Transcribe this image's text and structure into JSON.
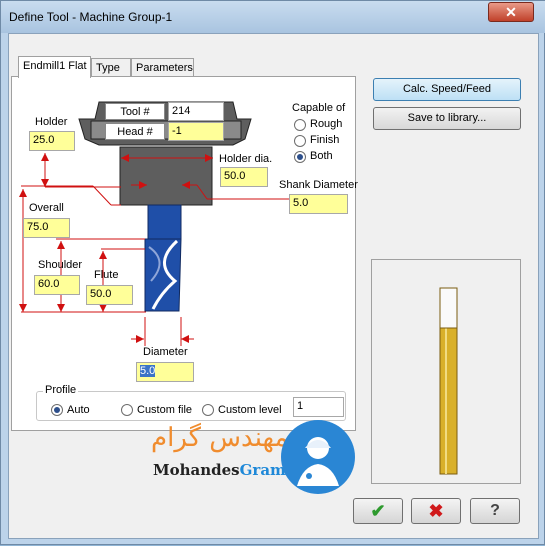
{
  "window": {
    "title": "Define Tool - Machine Group-1",
    "close_glyph": "✕"
  },
  "tabs": [
    {
      "label": "Endmill1 Flat"
    },
    {
      "label": "Type"
    },
    {
      "label": "Parameters"
    }
  ],
  "tool": {
    "tool_no_label": "Tool #",
    "tool_no_value": "214",
    "head_no_label": "Head #",
    "head_no_value": "-1",
    "holder_label": "Holder",
    "holder_value": "25.0",
    "holder_dia_label": "Holder dia.",
    "holder_dia_value": "50.0",
    "shank_diameter_label": "Shank Diameter",
    "shank_diameter_value": "5.0",
    "overall_label": "Overall",
    "overall_value": "75.0",
    "shoulder_label": "Shoulder",
    "shoulder_value": "60.0",
    "flute_label": "Flute",
    "flute_value": "50.0",
    "diameter_label": "Diameter",
    "diameter_value": "5.0"
  },
  "capable": {
    "title": "Capable of",
    "options": [
      "Rough",
      "Finish",
      "Both"
    ],
    "selected": "Both"
  },
  "profile": {
    "title": "Profile",
    "options": [
      "Auto",
      "Custom file",
      "Custom level"
    ],
    "selected": "Auto",
    "level_value": "1"
  },
  "buttons": {
    "calc": "Calc. Speed/Feed",
    "save_library": "Save to library..."
  },
  "footer": {
    "ok_glyph": "✔",
    "cancel_glyph": "✖",
    "help_glyph": "?"
  },
  "watermark": {
    "persian": "مهندس گرام",
    "latin_a": "Mohandes",
    "latin_b": "Gram"
  },
  "colors": {
    "field_yellow": "#ffff99",
    "dimension_red": "#d01010",
    "tool_body": "#5e5e5e",
    "flute_blue": "#1f4fa8",
    "preview_gold": "#d9b02a"
  }
}
